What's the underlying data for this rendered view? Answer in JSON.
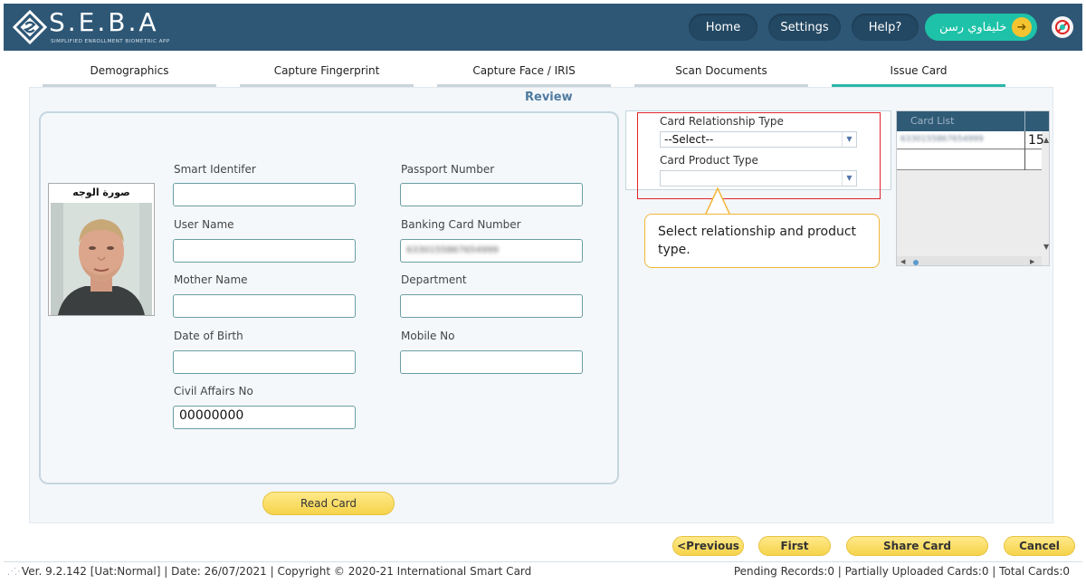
{
  "header": {
    "logo_title": "S.E.B.A",
    "logo_subtitle": "SIMPLIFIED ENROLLMENT BIOMETRIC APP",
    "nav": {
      "home": "Home",
      "settings": "Settings",
      "help": "Help?"
    },
    "user_name": "خليفاوي رسن",
    "colors": {
      "header_bg": "#2e5776",
      "user_btn": "#1ec2a8",
      "accent_yellow": "#f4c430"
    }
  },
  "tabs": [
    {
      "label": "Demographics"
    },
    {
      "label": "Capture Fingerprint"
    },
    {
      "label": "Capture Face / IRIS"
    },
    {
      "label": "Scan Documents"
    },
    {
      "label": "Issue Card",
      "active": true
    }
  ],
  "review": {
    "title": "Review",
    "photo_label": "صورة الوجه",
    "fields": {
      "smart_identifier": {
        "label": "Smart Identifer",
        "value": ""
      },
      "passport_number": {
        "label": "Passport Number",
        "value": ""
      },
      "user_name": {
        "label": "User Name",
        "value": ""
      },
      "banking_card_number": {
        "label": "Banking Card Number",
        "value": "6330155867654999"
      },
      "mother_name": {
        "label": "Mother Name",
        "value": ""
      },
      "department": {
        "label": "Department",
        "value": ""
      },
      "date_of_birth": {
        "label": "Date of Birth",
        "value": ""
      },
      "mobile_no": {
        "label": "Mobile No",
        "value": ""
      },
      "civil_affairs_no": {
        "label": "Civil Affairs No",
        "value": "00000000"
      }
    },
    "read_card_label": "Read Card"
  },
  "card_type": {
    "relationship_label": "Card Relationship Type",
    "relationship_value": "--Select--",
    "product_label": "Card Product Type",
    "product_value": ""
  },
  "callout_text": "Select relationship and product type.",
  "card_list": {
    "header": "Card List",
    "row1_blurred": "6330155867654999",
    "row1_value": "15"
  },
  "actions": {
    "previous": "<Previous",
    "first": "First",
    "share_card": "Share Card",
    "cancel": "Cancel"
  },
  "status": {
    "left": "Ver. 9.2.142 [Uat:Normal] | Date: 26/07/2021 | Copyright © 2020-21 International Smart Card",
    "right": "Pending Records:0 | Partially Uploaded Cards:0 | Total Cards:0"
  }
}
